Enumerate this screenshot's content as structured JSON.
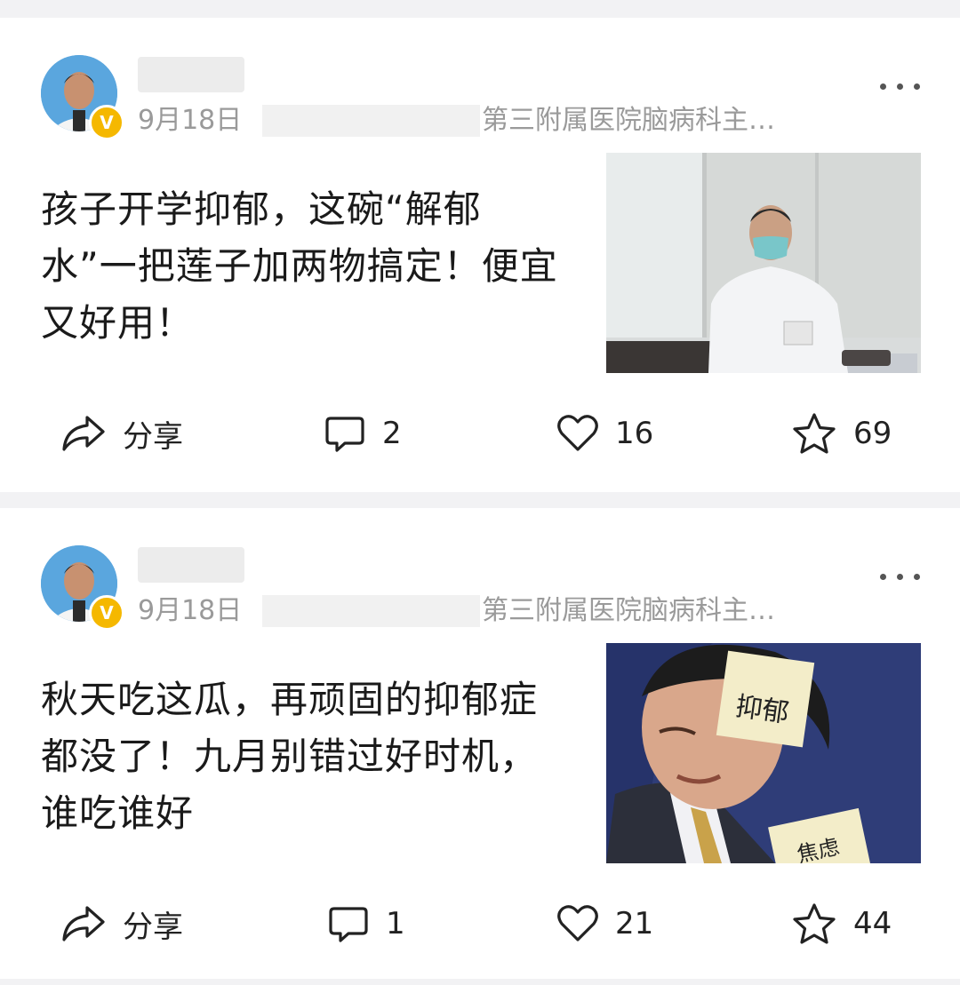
{
  "posts": [
    {
      "date": "9月18日",
      "org": "第三附属医院脑病科主…",
      "title": "孩子开学抑郁，这碗“解郁水”一把莲子加两物搞定！便宜又好用！",
      "share_label": "分享",
      "comments": "2",
      "likes": "16",
      "favorites": "69",
      "thumbnail_icon": "doctor-photo"
    },
    {
      "date": "9月18日",
      "org": "第三附属医院脑病科主…",
      "title": "秋天吃这瓜，再顽固的抑郁症都没了！九月别错过好时机，谁吃谁好",
      "share_label": "分享",
      "comments": "1",
      "likes": "21",
      "favorites": "44",
      "thumbnail_icon": "stressed-man-photo",
      "thumb_note_1": "抑郁",
      "thumb_note_2": "焦虑"
    }
  ],
  "badge_letter": "V",
  "colors": {
    "verified": "#f5b800",
    "meta_text": "#9a9a9a"
  }
}
